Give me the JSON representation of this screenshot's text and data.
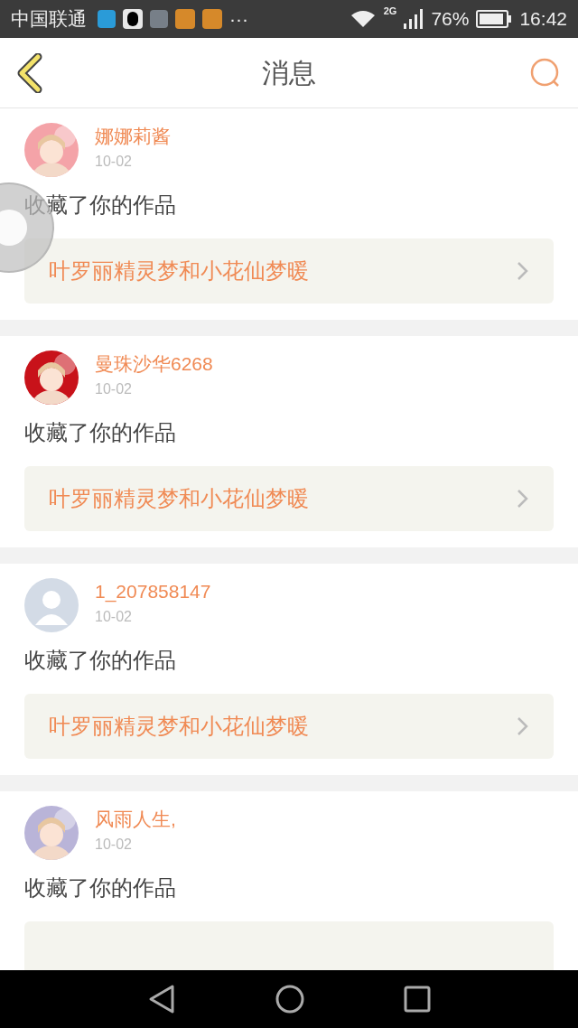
{
  "status_bar": {
    "carrier": "中国联通",
    "more": "···",
    "network": "2G",
    "battery": "76%",
    "time": "16:42"
  },
  "header": {
    "title": "消息"
  },
  "messages": [
    {
      "kind": "picture",
      "name": "娜娜莉酱",
      "date": "10-02",
      "action": "收藏了你的作品",
      "link": "叶罗丽精灵梦和小花仙梦暖"
    },
    {
      "kind": "picture",
      "name": "曼珠沙华6268",
      "date": "10-02",
      "action": "收藏了你的作品",
      "link": "叶罗丽精灵梦和小花仙梦暖"
    },
    {
      "kind": "default",
      "name": "1_207858147",
      "date": "10-02",
      "action": "收藏了你的作品",
      "link": "叶罗丽精灵梦和小花仙梦暖"
    },
    {
      "kind": "picture",
      "name": "风雨人生,",
      "date": "10-02",
      "action": "收藏了你的作品"
    }
  ]
}
